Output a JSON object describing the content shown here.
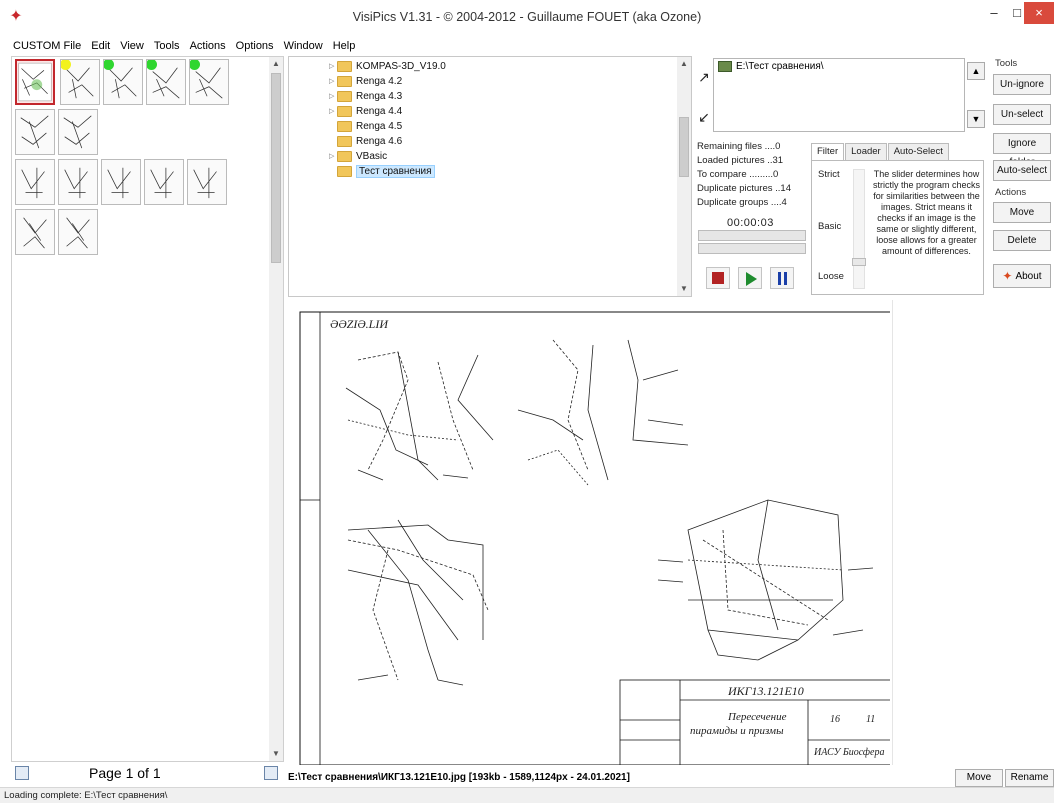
{
  "window": {
    "title": "VisiPics V1.31 - © 2004-2012 - Guillaume FOUET (aka Ozone)",
    "minimize": "–",
    "maximize": "□",
    "close": "×"
  },
  "menu": [
    "CUSTOM File",
    "Edit",
    "View",
    "Tools",
    "Actions",
    "Options",
    "Window",
    "Help"
  ],
  "thumbs": {
    "page_label": "Page 1 of 1"
  },
  "tree": {
    "items": [
      {
        "label": "KOMPAS-3D_V19.0",
        "expandable": true
      },
      {
        "label": "Renga 4.2",
        "expandable": true
      },
      {
        "label": "Renga 4.3",
        "expandable": true
      },
      {
        "label": "Renga 4.4",
        "expandable": true
      },
      {
        "label": "Renga 4.5",
        "expandable": false
      },
      {
        "label": "Renga 4.6",
        "expandable": false
      },
      {
        "label": "VBasic",
        "expandable": true
      },
      {
        "label": "Тест сравнения",
        "expandable": false,
        "selected": true
      }
    ]
  },
  "path_list": {
    "entry": "E:\\Тест сравнения\\"
  },
  "stats": {
    "remaining": "Remaining files ....0",
    "loaded": "Loaded pictures ..31",
    "to_compare": "To compare .........0",
    "duplicates": "Duplicate pictures ..14",
    "groups": "Duplicate groups ....4",
    "timer": "00:00:03"
  },
  "tabs": [
    "Filter",
    "Loader",
    "Auto-Select"
  ],
  "filter": {
    "strict": "Strict",
    "basic": "Basic",
    "loose": "Loose",
    "description": "The slider determines how strictly the program checks for similarities between the images. Strict means it checks if an image is the same or slightly different, loose allows for a greater amount of differences."
  },
  "tools": {
    "tools_label": "Tools",
    "unignore": "Un-ignore",
    "unselect": "Un-select",
    "ignore_folder": "Ignore folder",
    "auto_select": "Auto-select",
    "actions_label": "Actions",
    "move": "Move",
    "delete": "Delete",
    "about": "About"
  },
  "drawing": {
    "header_text": "ƏƏZIƏ.LIИ",
    "stamp_title": "ИКГ13.121Е10",
    "stamp_subject_1": "Пересечение",
    "stamp_subject_2": "пирамиды и призмы",
    "stamp_sheet": "16",
    "stamp_sheets": "11",
    "stamp_org": "ИАСУ Биосфера"
  },
  "file_info": "E:\\Тест сравнения\\ИКГ13.121Е10.jpg [193kb - 1589,1124px - 24.01.2021]",
  "bottom_buttons": {
    "move": "Move",
    "rename": "Rename"
  },
  "status": "Loading complete: E:\\Тест сравнения\\"
}
